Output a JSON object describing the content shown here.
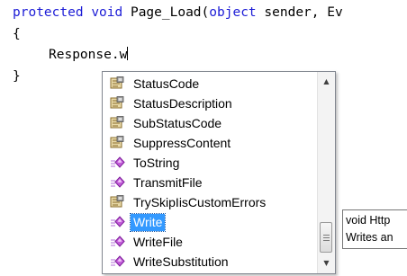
{
  "code": {
    "line1": {
      "kw1": "protected",
      "kw2": "void",
      "name": "Page_Load",
      "paren": "(",
      "kw3": "object",
      "rest": "sender, Ev"
    },
    "line2": "{",
    "line3": "Response.w",
    "line4": "}"
  },
  "intellisense": {
    "items": [
      {
        "label": "StatusCode",
        "icon": "property-icon"
      },
      {
        "label": "StatusDescription",
        "icon": "property-icon"
      },
      {
        "label": "SubStatusCode",
        "icon": "property-icon"
      },
      {
        "label": "SuppressContent",
        "icon": "property-icon"
      },
      {
        "label": "ToString",
        "icon": "method-icon"
      },
      {
        "label": "TransmitFile",
        "icon": "method-icon"
      },
      {
        "label": "TrySkipIisCustomErrors",
        "icon": "property-icon"
      },
      {
        "label": "Write",
        "icon": "method-icon"
      },
      {
        "label": "WriteFile",
        "icon": "method-icon"
      },
      {
        "label": "WriteSubstitution",
        "icon": "method-icon"
      }
    ],
    "selected_index": 7,
    "scroll_up": "▲",
    "scroll_down": "▼"
  },
  "tooltip": {
    "line1": "void Http",
    "line2": "Writes an"
  },
  "colors": {
    "keyword": "#1c1cd6",
    "selection": "#3399ff"
  }
}
